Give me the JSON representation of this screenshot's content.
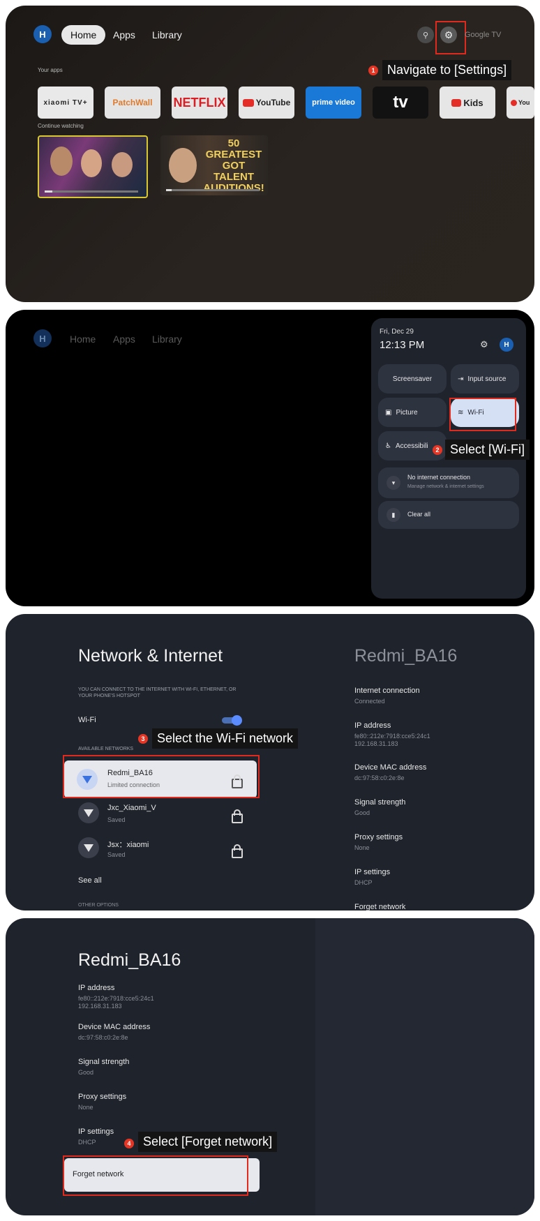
{
  "step1": {
    "avatar": "H",
    "nav": [
      "Home",
      "Apps",
      "Library"
    ],
    "google_tv": "Google TV",
    "your_apps": "Your apps",
    "apps": [
      "xiaomi TV+",
      "PatchWall",
      "NETFLIX",
      "YouTube",
      "prime video",
      "tv",
      "Kids",
      "You"
    ],
    "continue_watching": "Continue watching",
    "thumb2_text": "50 GREATEST GOT TALENT AUDITIONS!",
    "badge": "1",
    "callout": "Navigate to [Settings]"
  },
  "step2": {
    "avatar": "H",
    "nav": [
      "Home",
      "Apps",
      "Library"
    ],
    "date": "Fri, Dec 29",
    "time": "12:13 PM",
    "panel_avatar": "H",
    "tiles": [
      "Screensaver",
      "Input source",
      "Picture",
      "Wi-Fi",
      "Accessibili"
    ],
    "no_internet": "No internet connection",
    "no_internet_sub": "Manage network & internet settings",
    "clear_all": "Clear all",
    "badge": "2",
    "callout": "Select [Wi-Fi]"
  },
  "step3": {
    "title": "Network & Internet",
    "desc": "YOU CAN CONNECT TO THE INTERNET WITH WI-FI, ETHERNET, OR YOUR PHONE'S HOTSPOT",
    "wifi_label": "Wi-Fi",
    "available": "AVAILABLE NETWORKS",
    "networks": [
      {
        "name": "Redmi_BA16",
        "status": "Limited connection"
      },
      {
        "name": "Jxc_Xiaomi_V",
        "status": "Saved"
      },
      {
        "name": "Jsx：xiaomi",
        "status": "Saved"
      }
    ],
    "see_all": "See all",
    "other_options": "OTHER OPTIONS",
    "right_title": "Redmi_BA16",
    "details": [
      {
        "label": "Internet connection",
        "value": "Connected"
      },
      {
        "label": "IP address",
        "value": "fe80::212e:7918:cce5:24c1\n192.168.31.183"
      },
      {
        "label": "Device MAC address",
        "value": "dc:97:58:c0:2e:8e"
      },
      {
        "label": "Signal strength",
        "value": "Good"
      },
      {
        "label": "Proxy settings",
        "value": "None"
      },
      {
        "label": "IP settings",
        "value": "DHCP"
      },
      {
        "label": "Forget network",
        "value": ""
      }
    ],
    "badge": "3",
    "callout": "Select the Wi-Fi network"
  },
  "step4": {
    "title": "Redmi_BA16",
    "details": [
      {
        "label": "IP address",
        "value": "fe80::212e:7918:cce5:24c1\n192.168.31.183"
      },
      {
        "label": "Device MAC address",
        "value": "dc:97:58:c0:2e:8e"
      },
      {
        "label": "Signal strength",
        "value": "Good"
      },
      {
        "label": "Proxy settings",
        "value": "None"
      },
      {
        "label": "IP settings",
        "value": "DHCP"
      }
    ],
    "forget": "Forget network",
    "badge": "4",
    "callout": "Select [Forget network]"
  }
}
